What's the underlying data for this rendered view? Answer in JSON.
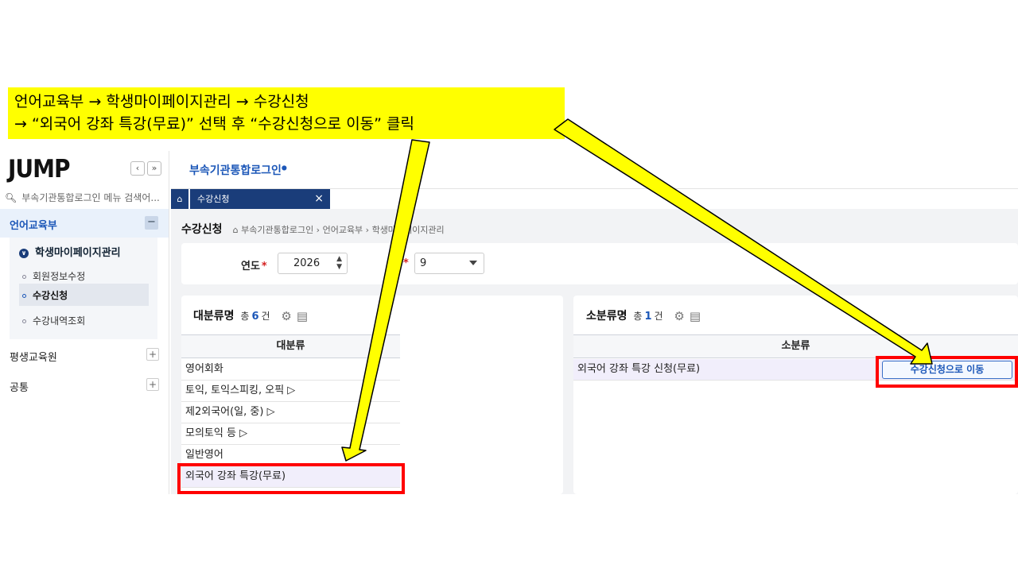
{
  "banner": {
    "line1": "언어교육부 → 학생마이페이지관리 → 수강신청",
    "line2": "→ “외국어 강좌 특강(무료)” 선택 후 “수강신청으로 이동” 클릭"
  },
  "sidebar": {
    "logo": "JUMP",
    "nav_prev": "‹",
    "nav_next": "»",
    "search_placeholder": "부속기관통합로그인 메뉴 검색어...",
    "section_lang": "언어교육부",
    "collapse_symbol": "−",
    "group_title": "학생마이페이지관리",
    "items": [
      "회원정보수정",
      "수강신청",
      "수강내역조회"
    ],
    "section_lifelong": "평생교육원",
    "section_common": "공통",
    "expand_symbol": "+"
  },
  "header": {
    "brand": "부속기관통합로그인",
    "tab_label": "수강신청",
    "tab_close": "×"
  },
  "page": {
    "title": "수강신청",
    "breadcrumb": "부속기관통합로그인 › 언어교육부 › 학생마이페이지관리"
  },
  "filters": {
    "year_label": "연도",
    "year_value": "2026",
    "required_mark": "*",
    "month_value": "9"
  },
  "major_panel": {
    "title": "대분류명",
    "count_prefix": "총",
    "count": "6",
    "count_suffix": "건",
    "column": "대분류",
    "rows": [
      "영어회화",
      "토익, 토익스피킹, 오픽 ▷",
      "제2외국어(일, 중) ▷",
      "모의토익 등 ▷",
      "일반영어",
      "외국어 강좌 특강(무료)"
    ]
  },
  "minor_panel": {
    "title": "소분류명",
    "count_prefix": "총",
    "count": "1",
    "count_suffix": "건",
    "column": "소분류",
    "rows": [
      "외국어 강좌 특강 신청(무료)"
    ],
    "action_button": "수강신청으로 이동"
  },
  "colors": {
    "banner": "#ffff00",
    "accent": "#1c57b8",
    "tab": "#1a3d7a",
    "highlight_box": "#ff0000"
  },
  "icons": {
    "search": "search-icon",
    "home": "home-icon",
    "settings": "gear-icon",
    "excel": "excel-icon"
  }
}
